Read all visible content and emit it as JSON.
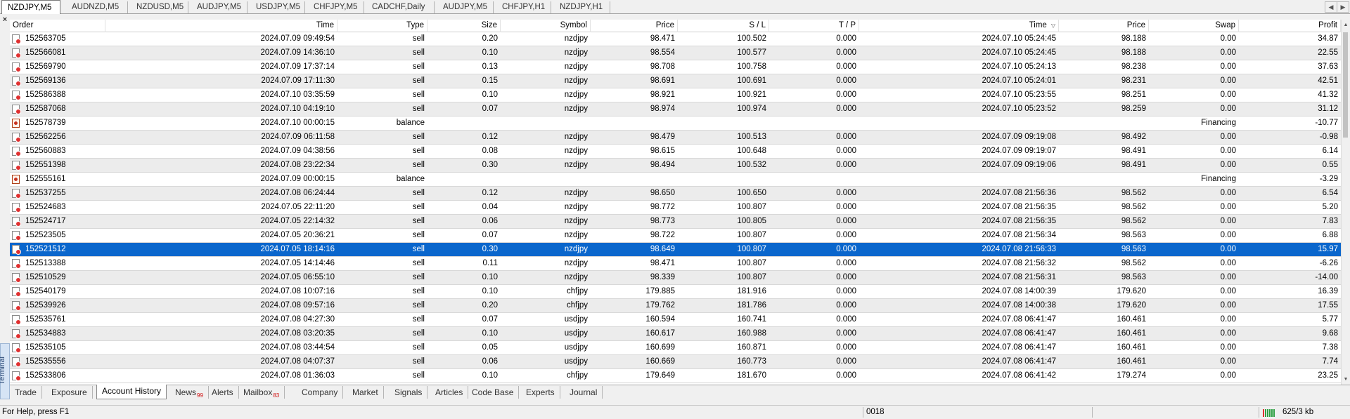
{
  "chart_tabs": [
    "NZDJPY,M5",
    "AUDNZD,M5",
    "NZDUSD,M5",
    "AUDJPY,M5",
    "USDJPY,M5",
    "CHFJPY,M5",
    "CADCHF,Daily",
    "AUDJPY,M5",
    "CHFJPY,H1",
    "NZDJPY,H1"
  ],
  "active_chart_tab": "NZDJPY,M5",
  "side_label": "Terminal",
  "close_glyph": "×",
  "table": {
    "columns": [
      "Order",
      "Time",
      "Type",
      "Size",
      "Symbol",
      "Price",
      "S / L",
      "T / P",
      "Time",
      "Price",
      "Swap",
      "Profit"
    ],
    "sort_column": "Time",
    "sort_glyph": "▽",
    "rows": [
      {
        "order": "152563705",
        "open_time": "2024.07.09 09:49:54",
        "type": "sell",
        "size": "0.20",
        "symbol": "nzdjpy",
        "price": "98.471",
        "sl": "100.502",
        "tp": "0.000",
        "close_time": "2024.07.10 05:24:45",
        "close_price": "98.188",
        "swap": "0.00",
        "profit": "34.87"
      },
      {
        "order": "152566081",
        "open_time": "2024.07.09 14:36:10",
        "type": "sell",
        "size": "0.10",
        "symbol": "nzdjpy",
        "price": "98.554",
        "sl": "100.577",
        "tp": "0.000",
        "close_time": "2024.07.10 05:24:45",
        "close_price": "98.188",
        "swap": "0.00",
        "profit": "22.55"
      },
      {
        "order": "152569790",
        "open_time": "2024.07.09 17:37:14",
        "type": "sell",
        "size": "0.13",
        "symbol": "nzdjpy",
        "price": "98.708",
        "sl": "100.758",
        "tp": "0.000",
        "close_time": "2024.07.10 05:24:13",
        "close_price": "98.238",
        "swap": "0.00",
        "profit": "37.63"
      },
      {
        "order": "152569136",
        "open_time": "2024.07.09 17:11:30",
        "type": "sell",
        "size": "0.15",
        "symbol": "nzdjpy",
        "price": "98.691",
        "sl": "100.691",
        "tp": "0.000",
        "close_time": "2024.07.10 05:24:01",
        "close_price": "98.231",
        "swap": "0.00",
        "profit": "42.51"
      },
      {
        "order": "152586388",
        "open_time": "2024.07.10 03:35:59",
        "type": "sell",
        "size": "0.10",
        "symbol": "nzdjpy",
        "price": "98.921",
        "sl": "100.921",
        "tp": "0.000",
        "close_time": "2024.07.10 05:23:55",
        "close_price": "98.251",
        "swap": "0.00",
        "profit": "41.32"
      },
      {
        "order": "152587068",
        "open_time": "2024.07.10 04:19:10",
        "type": "sell",
        "size": "0.07",
        "symbol": "nzdjpy",
        "price": "98.974",
        "sl": "100.974",
        "tp": "0.000",
        "close_time": "2024.07.10 05:23:52",
        "close_price": "98.259",
        "swap": "0.00",
        "profit": "31.12"
      },
      {
        "order": "152578739",
        "open_time": "2024.07.10 00:00:15",
        "type": "balance",
        "size": "",
        "symbol": "",
        "price": "",
        "sl": "",
        "tp": "",
        "close_time": "",
        "close_price": "",
        "swap": "Financing",
        "profit": "-10.77"
      },
      {
        "order": "152562256",
        "open_time": "2024.07.09 06:11:58",
        "type": "sell",
        "size": "0.12",
        "symbol": "nzdjpy",
        "price": "98.479",
        "sl": "100.513",
        "tp": "0.000",
        "close_time": "2024.07.09 09:19:08",
        "close_price": "98.492",
        "swap": "0.00",
        "profit": "-0.98"
      },
      {
        "order": "152560883",
        "open_time": "2024.07.09 04:38:56",
        "type": "sell",
        "size": "0.08",
        "symbol": "nzdjpy",
        "price": "98.615",
        "sl": "100.648",
        "tp": "0.000",
        "close_time": "2024.07.09 09:19:07",
        "close_price": "98.491",
        "swap": "0.00",
        "profit": "6.14"
      },
      {
        "order": "152551398",
        "open_time": "2024.07.08 23:22:34",
        "type": "sell",
        "size": "0.30",
        "symbol": "nzdjpy",
        "price": "98.494",
        "sl": "100.532",
        "tp": "0.000",
        "close_time": "2024.07.09 09:19:06",
        "close_price": "98.491",
        "swap": "0.00",
        "profit": "0.55"
      },
      {
        "order": "152555161",
        "open_time": "2024.07.09 00:00:15",
        "type": "balance",
        "size": "",
        "symbol": "",
        "price": "",
        "sl": "",
        "tp": "",
        "close_time": "",
        "close_price": "",
        "swap": "Financing",
        "profit": "-3.29"
      },
      {
        "order": "152537255",
        "open_time": "2024.07.08 06:24:44",
        "type": "sell",
        "size": "0.12",
        "symbol": "nzdjpy",
        "price": "98.650",
        "sl": "100.650",
        "tp": "0.000",
        "close_time": "2024.07.08 21:56:36",
        "close_price": "98.562",
        "swap": "0.00",
        "profit": "6.54"
      },
      {
        "order": "152524683",
        "open_time": "2024.07.05 22:11:20",
        "type": "sell",
        "size": "0.04",
        "symbol": "nzdjpy",
        "price": "98.772",
        "sl": "100.807",
        "tp": "0.000",
        "close_time": "2024.07.08 21:56:35",
        "close_price": "98.562",
        "swap": "0.00",
        "profit": "5.20"
      },
      {
        "order": "152524717",
        "open_time": "2024.07.05 22:14:32",
        "type": "sell",
        "size": "0.06",
        "symbol": "nzdjpy",
        "price": "98.773",
        "sl": "100.805",
        "tp": "0.000",
        "close_time": "2024.07.08 21:56:35",
        "close_price": "98.562",
        "swap": "0.00",
        "profit": "7.83"
      },
      {
        "order": "152523505",
        "open_time": "2024.07.05 20:36:21",
        "type": "sell",
        "size": "0.07",
        "symbol": "nzdjpy",
        "price": "98.722",
        "sl": "100.807",
        "tp": "0.000",
        "close_time": "2024.07.08 21:56:34",
        "close_price": "98.563",
        "swap": "0.00",
        "profit": "6.88"
      },
      {
        "order": "152521512",
        "open_time": "2024.07.05 18:14:16",
        "type": "sell",
        "size": "0.30",
        "symbol": "nzdjpy",
        "price": "98.649",
        "sl": "100.807",
        "tp": "0.000",
        "close_time": "2024.07.08 21:56:33",
        "close_price": "98.563",
        "swap": "0.00",
        "profit": "15.97",
        "selected": true
      },
      {
        "order": "152513388",
        "open_time": "2024.07.05 14:14:46",
        "type": "sell",
        "size": "0.11",
        "symbol": "nzdjpy",
        "price": "98.471",
        "sl": "100.807",
        "tp": "0.000",
        "close_time": "2024.07.08 21:56:32",
        "close_price": "98.562",
        "swap": "0.00",
        "profit": "-6.26"
      },
      {
        "order": "152510529",
        "open_time": "2024.07.05 06:55:10",
        "type": "sell",
        "size": "0.10",
        "symbol": "nzdjpy",
        "price": "98.339",
        "sl": "100.807",
        "tp": "0.000",
        "close_time": "2024.07.08 21:56:31",
        "close_price": "98.563",
        "swap": "0.00",
        "profit": "-14.00"
      },
      {
        "order": "152540179",
        "open_time": "2024.07.08 10:07:16",
        "type": "sell",
        "size": "0.10",
        "symbol": "chfjpy",
        "price": "179.885",
        "sl": "181.916",
        "tp": "0.000",
        "close_time": "2024.07.08 14:00:39",
        "close_price": "179.620",
        "swap": "0.00",
        "profit": "16.39"
      },
      {
        "order": "152539926",
        "open_time": "2024.07.08 09:57:16",
        "type": "sell",
        "size": "0.20",
        "symbol": "chfjpy",
        "price": "179.762",
        "sl": "181.786",
        "tp": "0.000",
        "close_time": "2024.07.08 14:00:38",
        "close_price": "179.620",
        "swap": "0.00",
        "profit": "17.55"
      },
      {
        "order": "152535761",
        "open_time": "2024.07.08 04:27:30",
        "type": "sell",
        "size": "0.07",
        "symbol": "usdjpy",
        "price": "160.594",
        "sl": "160.741",
        "tp": "0.000",
        "close_time": "2024.07.08 06:41:47",
        "close_price": "160.461",
        "swap": "0.00",
        "profit": "5.77"
      },
      {
        "order": "152534883",
        "open_time": "2024.07.08 03:20:35",
        "type": "sell",
        "size": "0.10",
        "symbol": "usdjpy",
        "price": "160.617",
        "sl": "160.988",
        "tp": "0.000",
        "close_time": "2024.07.08 06:41:47",
        "close_price": "160.461",
        "swap": "0.00",
        "profit": "9.68"
      },
      {
        "order": "152535105",
        "open_time": "2024.07.08 03:44:54",
        "type": "sell",
        "size": "0.05",
        "symbol": "usdjpy",
        "price": "160.699",
        "sl": "160.871",
        "tp": "0.000",
        "close_time": "2024.07.08 06:41:47",
        "close_price": "160.461",
        "swap": "0.00",
        "profit": "7.38"
      },
      {
        "order": "152535556",
        "open_time": "2024.07.08 04:07:37",
        "type": "sell",
        "size": "0.06",
        "symbol": "usdjpy",
        "price": "160.669",
        "sl": "160.773",
        "tp": "0.000",
        "close_time": "2024.07.08 06:41:47",
        "close_price": "160.461",
        "swap": "0.00",
        "profit": "7.74"
      },
      {
        "order": "152533806",
        "open_time": "2024.07.08 01:36:03",
        "type": "sell",
        "size": "0.10",
        "symbol": "chfjpy",
        "price": "179.649",
        "sl": "181.670",
        "tp": "0.000",
        "close_time": "2024.07.08 06:41:42",
        "close_price": "179.274",
        "swap": "0.00",
        "profit": "23.25"
      }
    ]
  },
  "bottom_tabs": [
    {
      "label": "Trade",
      "badge": ""
    },
    {
      "label": "Exposure",
      "badge": ""
    },
    {
      "label": "Account History",
      "badge": "",
      "active": true
    },
    {
      "label": "News",
      "badge": "99"
    },
    {
      "label": "Alerts",
      "badge": ""
    },
    {
      "label": "Mailbox",
      "badge": "83"
    },
    {
      "label": "Company",
      "badge": ""
    },
    {
      "label": "Market",
      "badge": ""
    },
    {
      "label": "Signals",
      "badge": ""
    },
    {
      "label": "Articles",
      "badge": ""
    },
    {
      "label": "Code Base",
      "badge": ""
    },
    {
      "label": "Experts",
      "badge": ""
    },
    {
      "label": "Journal",
      "badge": ""
    }
  ],
  "status": {
    "help": "For Help, press F1",
    "code": "0018",
    "traffic": "625/3 kb"
  },
  "colors": {
    "selected_row": "#0a66cc",
    "badge": "#d01010",
    "conn_ok": "#2ea043"
  }
}
